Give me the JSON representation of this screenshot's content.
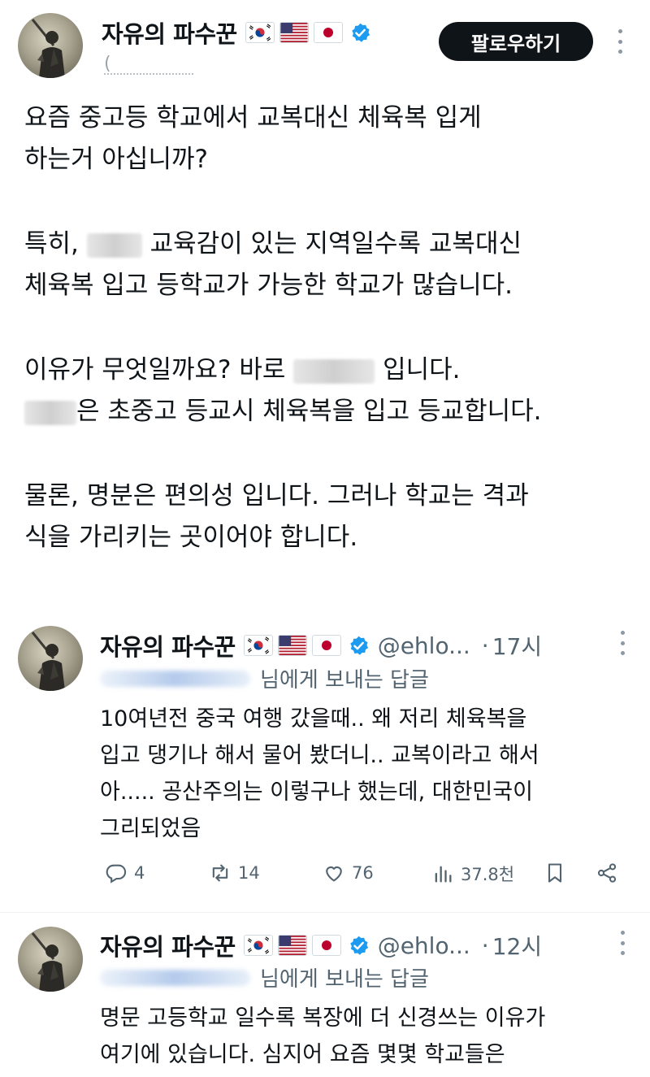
{
  "tweet": {
    "author_name": "자유의 파수꾼",
    "follow_label": "팔로우하기",
    "handle_hint": "(",
    "lines_p1": [
      "요즘 중고등 학교에서 교복대신 체육복 입게",
      "하는거 아십니까?"
    ],
    "p2_l1_pre": "특히,",
    "p2_l1_post": "교육감이 있는 지역일수록 교복대신",
    "p2_l2": "체육복 입고 등학교가 가능한 학교가 많습니다.",
    "p3_l1_pre": "이유가 무엇일까요? 바로",
    "p3_l1_post": "입니다.",
    "p3_l2_post": "은 초중고 등교시 체육복을 입고 등교합니다.",
    "lines_p4": [
      "물론, 명분은 편의성 입니다. 그러나 학교는 격과",
      "식을 가리키는 곳이어야 합니다."
    ]
  },
  "replies": [
    {
      "author_name": "자유의 파수꾼",
      "handle": "@ehlo...",
      "sep": "·",
      "time": "17시",
      "reply_to": "님에게 보내는 답글",
      "lines": [
        "10여년전 중국 여행 갔을때.. 왜 저리 체육복을",
        "입고 댕기나 해서 물어 봤더니.. 교복이라고 해서",
        "아..... 공산주의는 이렇구나 했는데,  대한민국이",
        "그리되었음"
      ],
      "stats": {
        "replies": "4",
        "reposts": "14",
        "likes": "76",
        "views": "37.8천"
      }
    },
    {
      "author_name": "자유의 파수꾼",
      "handle": "@ehlo...",
      "sep": "·",
      "time": "12시",
      "reply_to": "님에게 보내는 답글",
      "lines": [
        "명문 고등학교 일수록 복장에 더 신경쓰는 이유가",
        "여기에 있습니다. 심지어 요즘 몇몇 학교들은"
      ]
    }
  ],
  "colors": {
    "text": "#0f1419",
    "secondary": "#536471",
    "verified": "#1d9bf0",
    "follow_bg": "#0f1419"
  },
  "icons": [
    "korea-flag-icon",
    "usa-flag-icon",
    "japan-flag-icon",
    "verified-badge-icon",
    "more-options-icon",
    "reply-icon",
    "repost-icon",
    "like-icon",
    "views-icon",
    "bookmark-icon",
    "share-icon"
  ]
}
